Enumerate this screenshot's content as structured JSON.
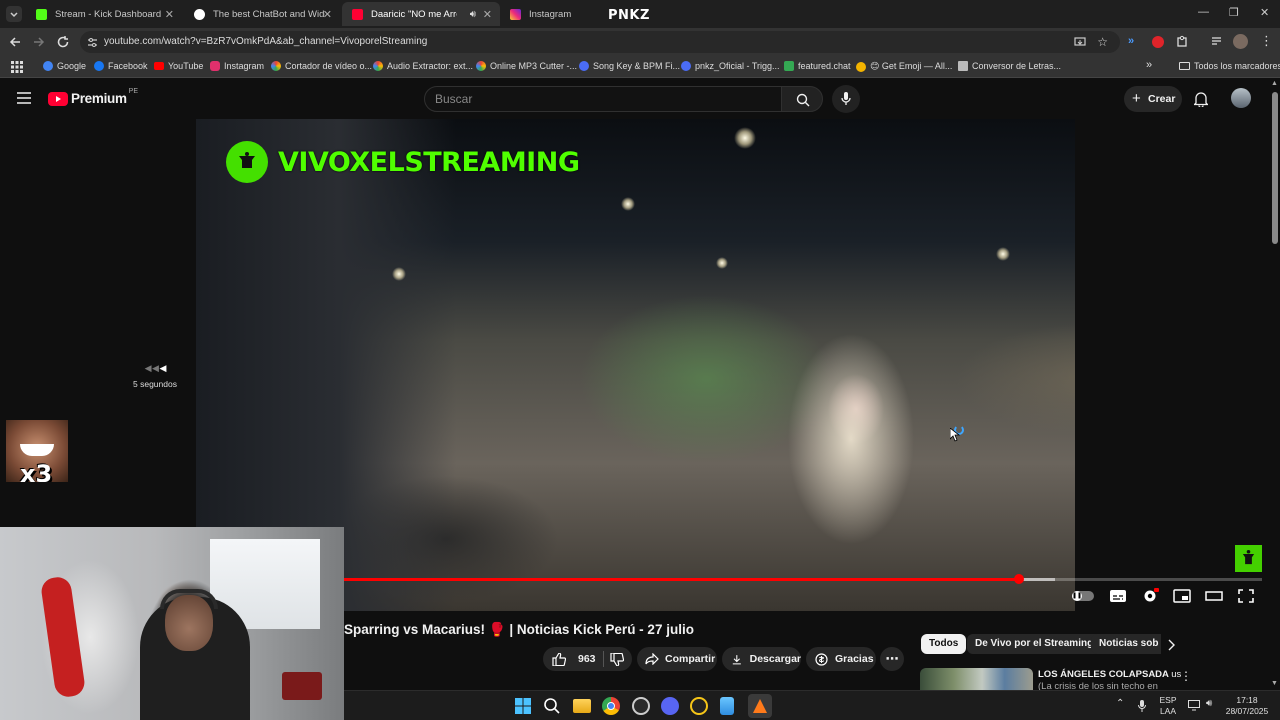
{
  "browser": {
    "tabs": [
      {
        "label": "Stream - Kick Dashboard",
        "color": "#53fc18"
      },
      {
        "label": "The best ChatBot and Widgets",
        "color": "#ffffff"
      },
      {
        "label": "Daaricic \"NO me Arrep",
        "color": "#ff0033"
      },
      {
        "label": "Instagram",
        "color": "#e1306c"
      }
    ],
    "center_logo": "PNKZ",
    "url": "youtube.com/watch?v=BzR7vOmkPdA&ab_channel=VivoporelStreaming",
    "bookmarks": [
      {
        "label": "Google",
        "color": "#4285f4"
      },
      {
        "label": "Facebook",
        "color": "#1877f2"
      },
      {
        "label": "YouTube",
        "color": "#ff0000"
      },
      {
        "label": "Instagram",
        "color": "#e1306c"
      },
      {
        "label": "Cortador de vídeo o...",
        "color": "#f4b400"
      },
      {
        "label": "Audio Extractor: ext...",
        "color": "#f4b400"
      },
      {
        "label": "Online MP3 Cutter -...",
        "color": "#f4b400"
      },
      {
        "label": "Song Key & BPM Fi...",
        "color": "#4a6cf7"
      },
      {
        "label": "pnkz_Oficial - Trigg...",
        "color": "#4a6cf7"
      },
      {
        "label": "featured.chat",
        "color": "#34a853"
      },
      {
        "label": "😊 Get Emoji — All...",
        "color": "#f4b400"
      },
      {
        "label": "Conversor de Letras...",
        "color": "#bbbbbb"
      }
    ],
    "all_bookmarks": "Todos los marcadores"
  },
  "youtube": {
    "logo_text": "Premium",
    "region": "PE",
    "search_placeholder": "Buscar",
    "create_label": "Crear",
    "video": {
      "overlay_brand": "VIVOXELSTREAMING",
      "seek_label": "5 segundos",
      "progress_played": 0.735,
      "progress_buffered": 0.775
    },
    "title": "Sparring vs Macarius! 🥊 | Noticias Kick Perú - 27 julio",
    "like_count": "963",
    "share_label": "Compartir",
    "download_label": "Descargar",
    "thanks_label": "Gracias",
    "chips": [
      "Todos",
      "De Vivo por el Streaming",
      "Noticias sob"
    ],
    "rec": {
      "title_line1": "LOS ÁNGELES COLAPSADA",
      "title_suffix": "us",
      "title_line2": "(La crisis de los sin techo en"
    }
  },
  "reaction_overlay": "x3",
  "taskbar": {
    "lang_top": "ESP",
    "lang_bottom": "LAA",
    "time": "17:18",
    "date": "28/07/2025"
  }
}
